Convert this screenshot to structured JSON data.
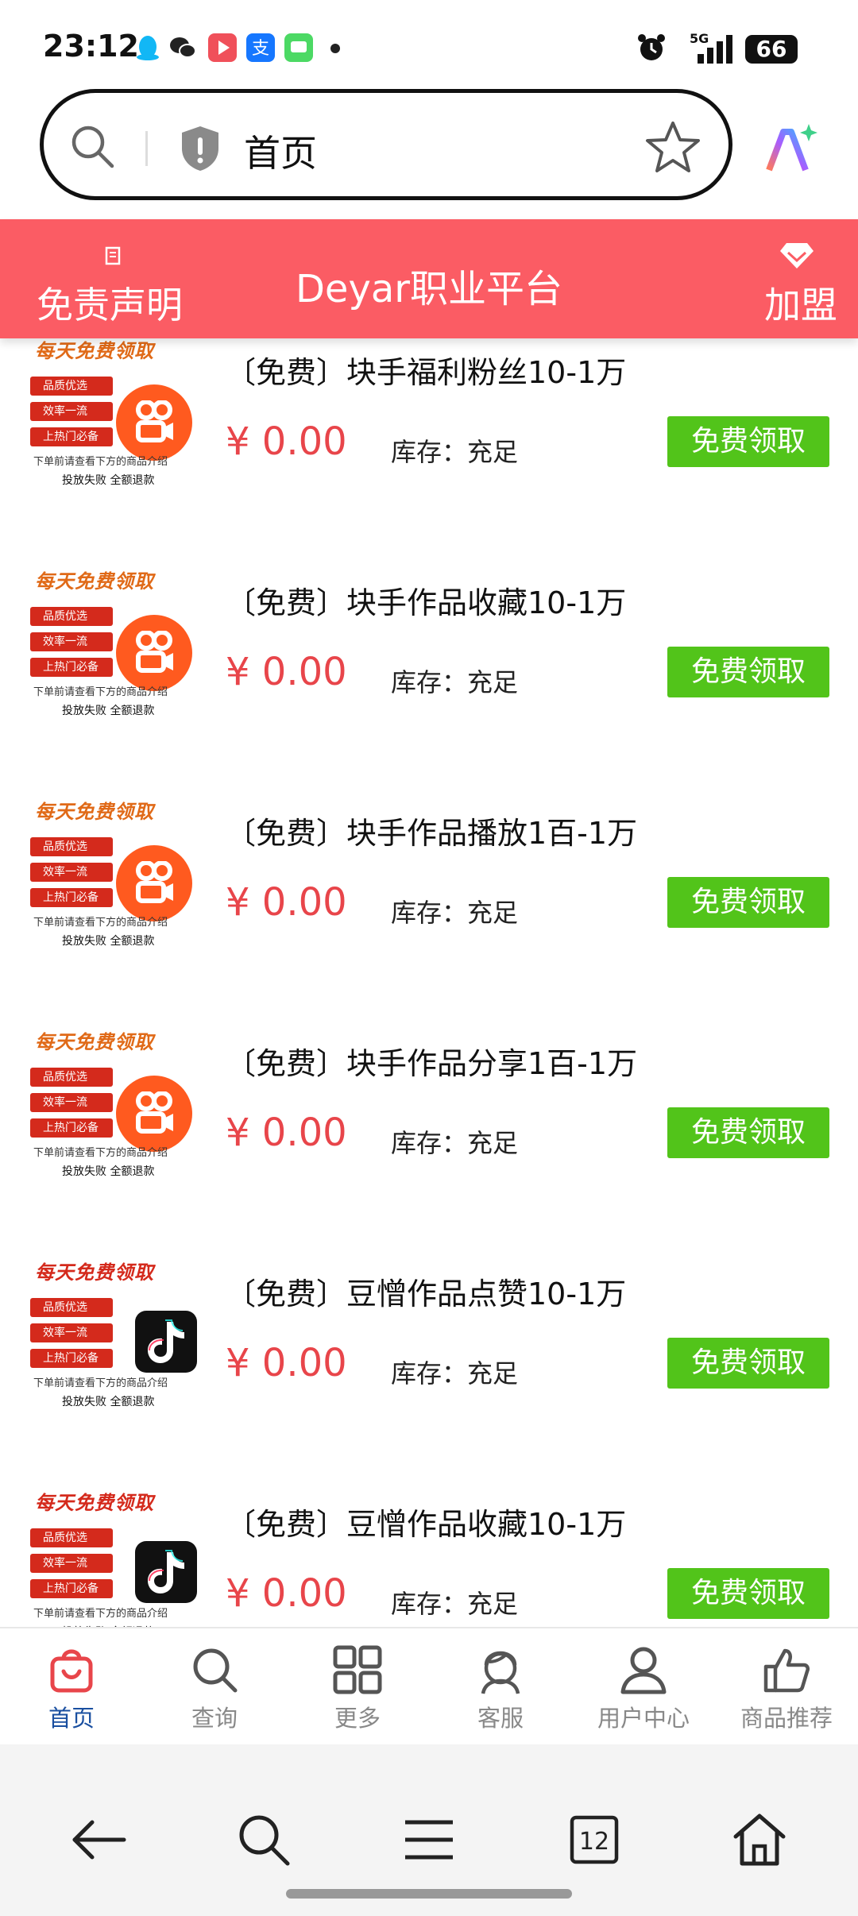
{
  "status_bar": {
    "time": "23:12",
    "network": "5G",
    "battery": "66",
    "app_icons": [
      {
        "name": "qq-icon",
        "color": "#12b7f5"
      },
      {
        "name": "wechat-icon",
        "color": "#222222"
      },
      {
        "name": "video-app-icon",
        "color": "#f0505a"
      },
      {
        "name": "alipay-icon",
        "color": "#1677ff"
      },
      {
        "name": "message-app-icon",
        "color": "#4cd964"
      }
    ]
  },
  "browser": {
    "address_text": "首页"
  },
  "header": {
    "left_label": "免责声明",
    "title": "Deyar职业平台",
    "right_label": "加盟",
    "color": "#fb5c64"
  },
  "products": [
    {
      "name": "〔免费〕块手福利粉丝10-1万",
      "price": "¥ 0.00",
      "stock": "库存：充足",
      "button": "免费领取",
      "platform": "kuaishou"
    },
    {
      "name": "〔免费〕块手作品收藏10-1万",
      "price": "¥ 0.00",
      "stock": "库存：充足",
      "button": "免费领取",
      "platform": "kuaishou"
    },
    {
      "name": "〔免费〕块手作品播放1百-1万",
      "price": "¥ 0.00",
      "stock": "库存：充足",
      "button": "免费领取",
      "platform": "kuaishou"
    },
    {
      "name": "〔免费〕块手作品分享1百-1万",
      "price": "¥ 0.00",
      "stock": "库存：充足",
      "button": "免费领取",
      "platform": "kuaishou"
    },
    {
      "name": "〔免费〕豆憎作品点赞10-1万",
      "price": "¥ 0.00",
      "stock": "库存：充足",
      "button": "免费领取",
      "platform": "douyin"
    },
    {
      "name": "〔免费〕豆憎作品收藏10-1万",
      "price": "¥ 0.00",
      "stock": "库存：充足",
      "button": "免费领取",
      "platform": "douyin"
    }
  ],
  "thumb_text": {
    "kuaishou_banner": "每天免费领取",
    "douyin_banner": "每天免费领取",
    "tags": [
      "品质优选",
      "效率一流",
      "上热门必备"
    ],
    "footer1": "下单前请查看下方的商品介绍",
    "footer2": "投放失败 全额退款"
  },
  "tabs": [
    {
      "label": "首页",
      "icon": "shop-bag-icon",
      "active": true
    },
    {
      "label": "查询",
      "icon": "search-icon",
      "active": false
    },
    {
      "label": "更多",
      "icon": "grid-icon",
      "active": false
    },
    {
      "label": "客服",
      "icon": "customer-service-icon",
      "active": false
    },
    {
      "label": "用户中心",
      "icon": "user-icon",
      "active": false
    },
    {
      "label": "商品推荐",
      "icon": "thumbs-up-icon",
      "active": false
    }
  ],
  "browser_nav": {
    "tab_count": "12"
  },
  "colors": {
    "accent_red": "#fb5c64",
    "price_red": "#e8454a",
    "button_green": "#52c41a",
    "tab_active": "#e8454a"
  }
}
